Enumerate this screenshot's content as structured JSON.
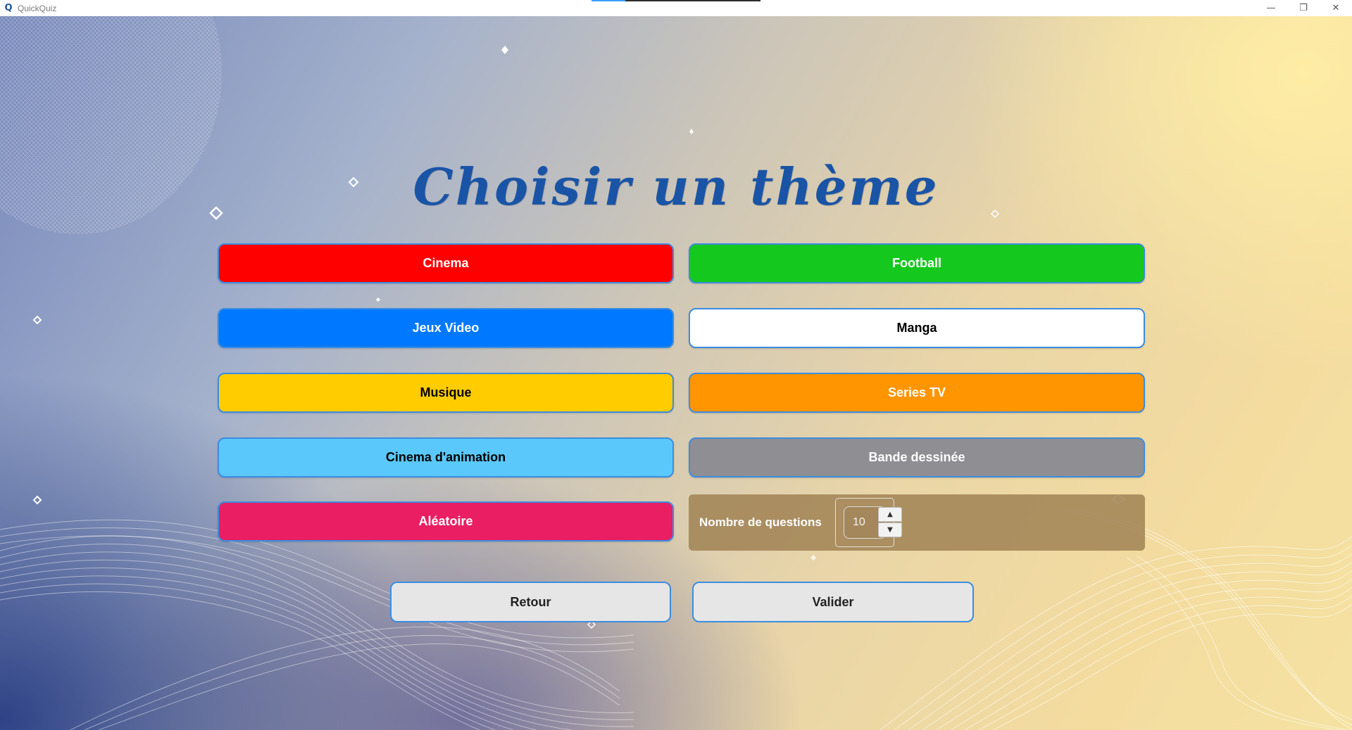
{
  "window": {
    "app_icon": "quickquiz-logo-icon",
    "title": "QuickQuiz",
    "controls": {
      "minimize": "minimize-icon",
      "restore": "restore-icon",
      "close": "close-icon"
    }
  },
  "page": {
    "title": "Choisir un thème"
  },
  "themes": [
    {
      "label": "Cinema",
      "bg": "#ff0000",
      "fg": "#ffffff"
    },
    {
      "label": "Football",
      "bg": "#14c81e",
      "fg": "#ffffff"
    },
    {
      "label": "Jeux Video",
      "bg": "#0078ff",
      "fg": "#ffffff"
    },
    {
      "label": "Manga",
      "bg": "#ffffff",
      "fg": "#000000"
    },
    {
      "label": "Musique",
      "bg": "#ffcc00",
      "fg": "#000000"
    },
    {
      "label": "Series TV",
      "bg": "#ff9500",
      "fg": "#ffffff"
    },
    {
      "label": "Cinema d'animation",
      "bg": "#5ac8fa",
      "fg": "#000000"
    },
    {
      "label": "Bande dessinée",
      "bg": "#8e8e93",
      "fg": "#ffffff"
    },
    {
      "label": "Aléatoire",
      "bg": "#e91e63",
      "fg": "#ffffff"
    }
  ],
  "questions": {
    "label": "Nombre de questions",
    "value": "10",
    "up_icon": "triangle-up-icon",
    "down_icon": "triangle-down-icon"
  },
  "buttons": {
    "back": "Retour",
    "validate": "Valider"
  }
}
